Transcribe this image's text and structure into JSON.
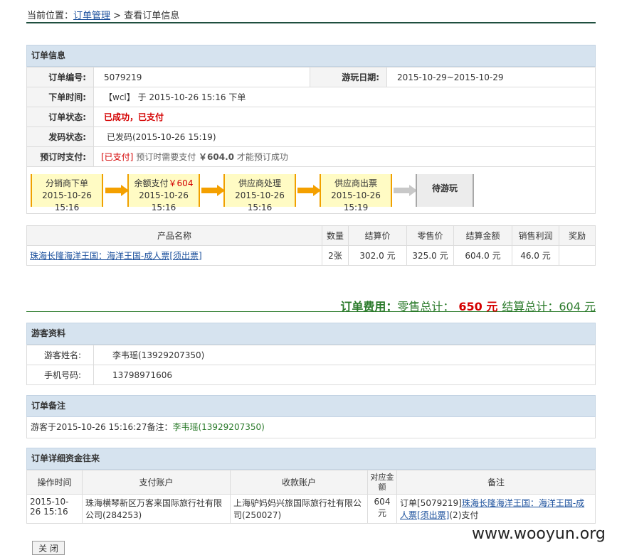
{
  "breadcrumb": {
    "prefix": "当前位置：",
    "link": "订单管理",
    "sep": " > ",
    "current": "查看订单信息"
  },
  "order_info": {
    "title": "订单信息",
    "order_no_label": "订单编号:",
    "order_no": "5079219",
    "play_date_label": "游玩日期:",
    "play_date": "2015-10-29~2015-10-29",
    "order_time_label": "下单时间:",
    "order_time_user": "【wcl】",
    "order_time_text": "于 2015-10-26 15:16 下单",
    "status_label": "订单状态:",
    "status": "已成功，已支付",
    "code_label": "发码状态:",
    "code_status": "已发码(2015-10-26 15:19)",
    "prepay_label": "预订时支付:",
    "prepay_tag": "[已支付]",
    "prepay_text1": "预订时需要支付",
    "prepay_amount": "￥604.0",
    "prepay_text2": "才能预订成功"
  },
  "flow": [
    {
      "title": "分销商下单",
      "time": "2015-10-26 15:16"
    },
    {
      "title": "余额支付",
      "amount": "￥604",
      "time": "2015-10-26 15:16"
    },
    {
      "title": "供应商处理",
      "time": "2015-10-26 15:16"
    },
    {
      "title": "供应商出票",
      "time": "2015-10-26 15:19"
    },
    {
      "title": "待游玩"
    }
  ],
  "product_table": {
    "headers": [
      "产品名称",
      "数量",
      "结算价",
      "零售价",
      "结算金额",
      "销售利润",
      "奖励"
    ],
    "row": {
      "name": "珠海长隆海洋王国：海洋王国-成人票[须出票]",
      "qty": "2张",
      "settle_price": "302.0 元",
      "retail_price": "325.0 元",
      "settle_amount": "604.0 元",
      "profit": "46.0 元",
      "reward": ""
    }
  },
  "total": {
    "label": "订单费用：",
    "retail_label": "零售总计：",
    "retail_amount": "650 元",
    "settle_label": "结算总计：604 元"
  },
  "tourist": {
    "title": "游客资料",
    "name_label": "游客姓名:",
    "name": "李韦瑶(13929207350)",
    "phone_label": "手机号码:",
    "phone": "13798971606"
  },
  "remark": {
    "title": "订单备注",
    "text": "游客于2015-10-26 15:16:27备注：",
    "who": "李韦瑶(13929207350)"
  },
  "finance": {
    "title": "订单详细资金往来",
    "headers": [
      "操作时间",
      "支付账户",
      "收款账户",
      "对应金额",
      "备注"
    ],
    "row": {
      "time": "2015-10-26 15:16",
      "payer": "珠海横琴新区万客来国际旅行社有限公司(284253)",
      "payee": "上海驴妈妈兴旅国际旅行社有限公司(250027)",
      "amount": "604元",
      "note_prefix": "订单[5079219]",
      "note_link": "珠海长隆海洋王国：海洋王国-成人票[须出票]",
      "note_suffix": "(2)支付"
    }
  },
  "close_button": "关 闭",
  "watermark": "www.wooyun.org",
  "colors": {
    "header_bg": "#d6e3ef",
    "accent_red": "#d40000",
    "green": "#2a7a2a",
    "step_bg": "#fffbc4",
    "arrow_orange": "#f4a000"
  }
}
